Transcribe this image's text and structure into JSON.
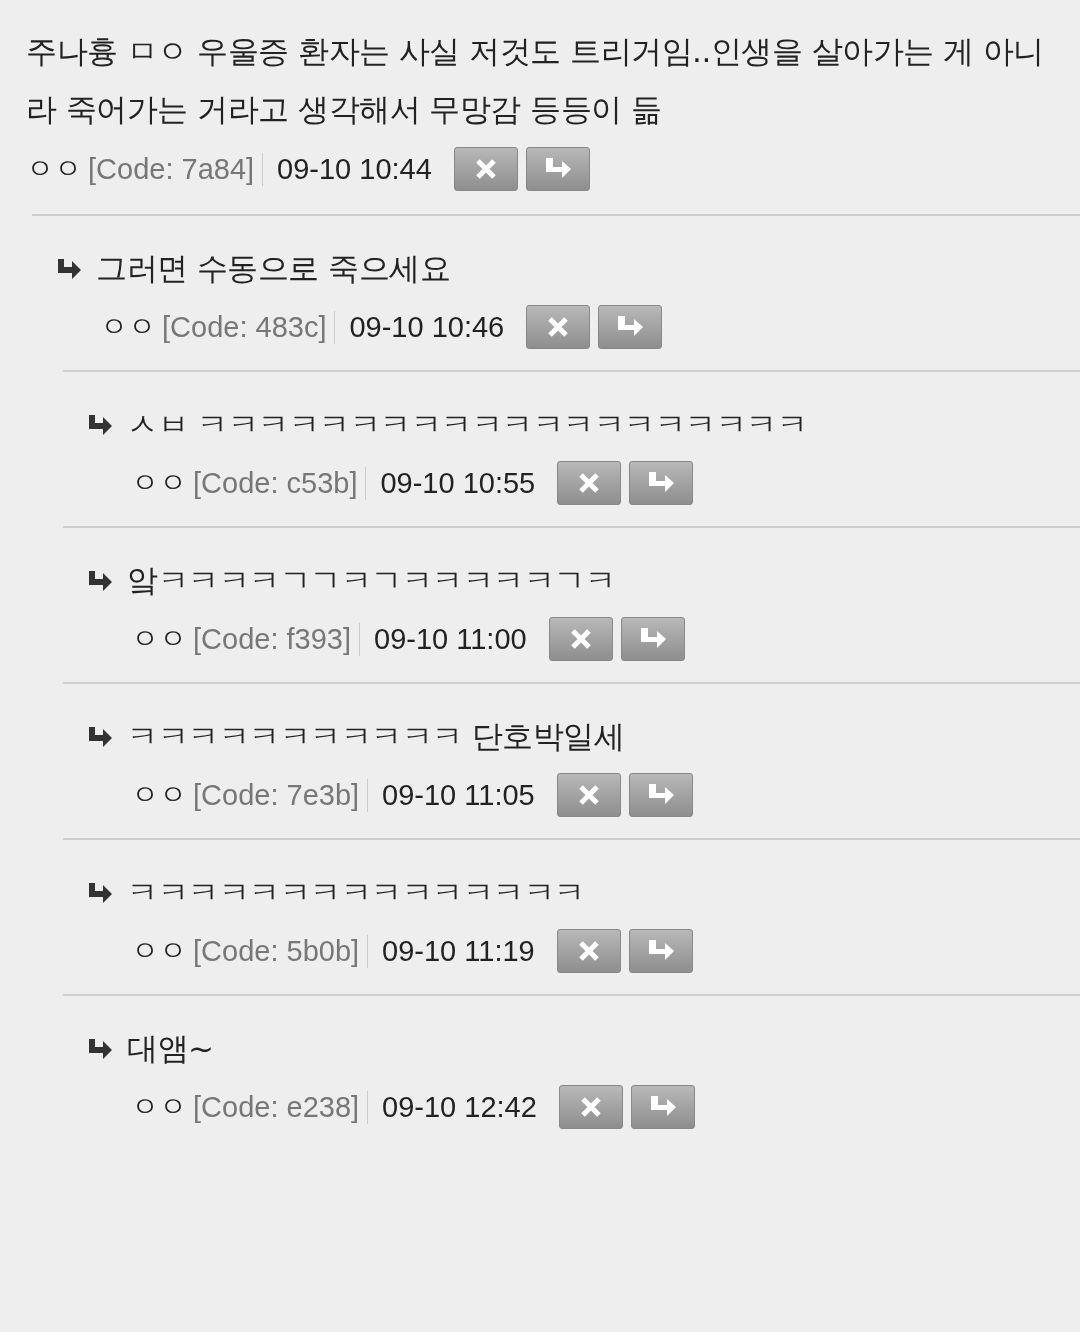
{
  "comment": {
    "text": "주나흉 ㅁㅇ 우울증 환자는 사실 저것도 트리거임..인생을 살아가는 게 아니라 죽어가는 거라고 생각해서 무망감 등등이 듦",
    "author": "ㅇㅇ",
    "code": "[Code: 7a84]",
    "time": "09-10 10:44",
    "replies": [
      {
        "text": "그러면 수동으로 죽으세요",
        "author": "ㅇㅇ",
        "code": "[Code: 483c]",
        "time": "09-10 10:46",
        "children": [
          {
            "text": "ㅅㅂ ㅋㅋㅋㅋㅋㅋㅋㅋㅋㅋㅋㅋㅋㅋㅋㅋㅋㅋㅋㅋ",
            "author": "ㅇㅇ",
            "code": "[Code: c53b]",
            "time": "09-10 10:55"
          },
          {
            "text": "앜ㅋㅋㅋㅋㄱㄱㅋㄱㅋㅋㅋㅋㅋㄱㅋ",
            "author": "ㅇㅇ",
            "code": "[Code: f393]",
            "time": "09-10 11:00"
          },
          {
            "text": "ㅋㅋㅋㅋㅋㅋㅋㅋㅋㅋㅋ 단호박일세",
            "author": "ㅇㅇ",
            "code": "[Code: 7e3b]",
            "time": "09-10 11:05"
          },
          {
            "text": "ㅋㅋㅋㅋㅋㅋㅋㅋㅋㅋㅋㅋㅋㅋㅋ",
            "author": "ㅇㅇ",
            "code": "[Code: 5b0b]",
            "time": "09-10 11:19"
          },
          {
            "text": "대앰~",
            "author": "ㅇㅇ",
            "code": "[Code: e238]",
            "time": "09-10 12:42"
          }
        ]
      }
    ]
  }
}
